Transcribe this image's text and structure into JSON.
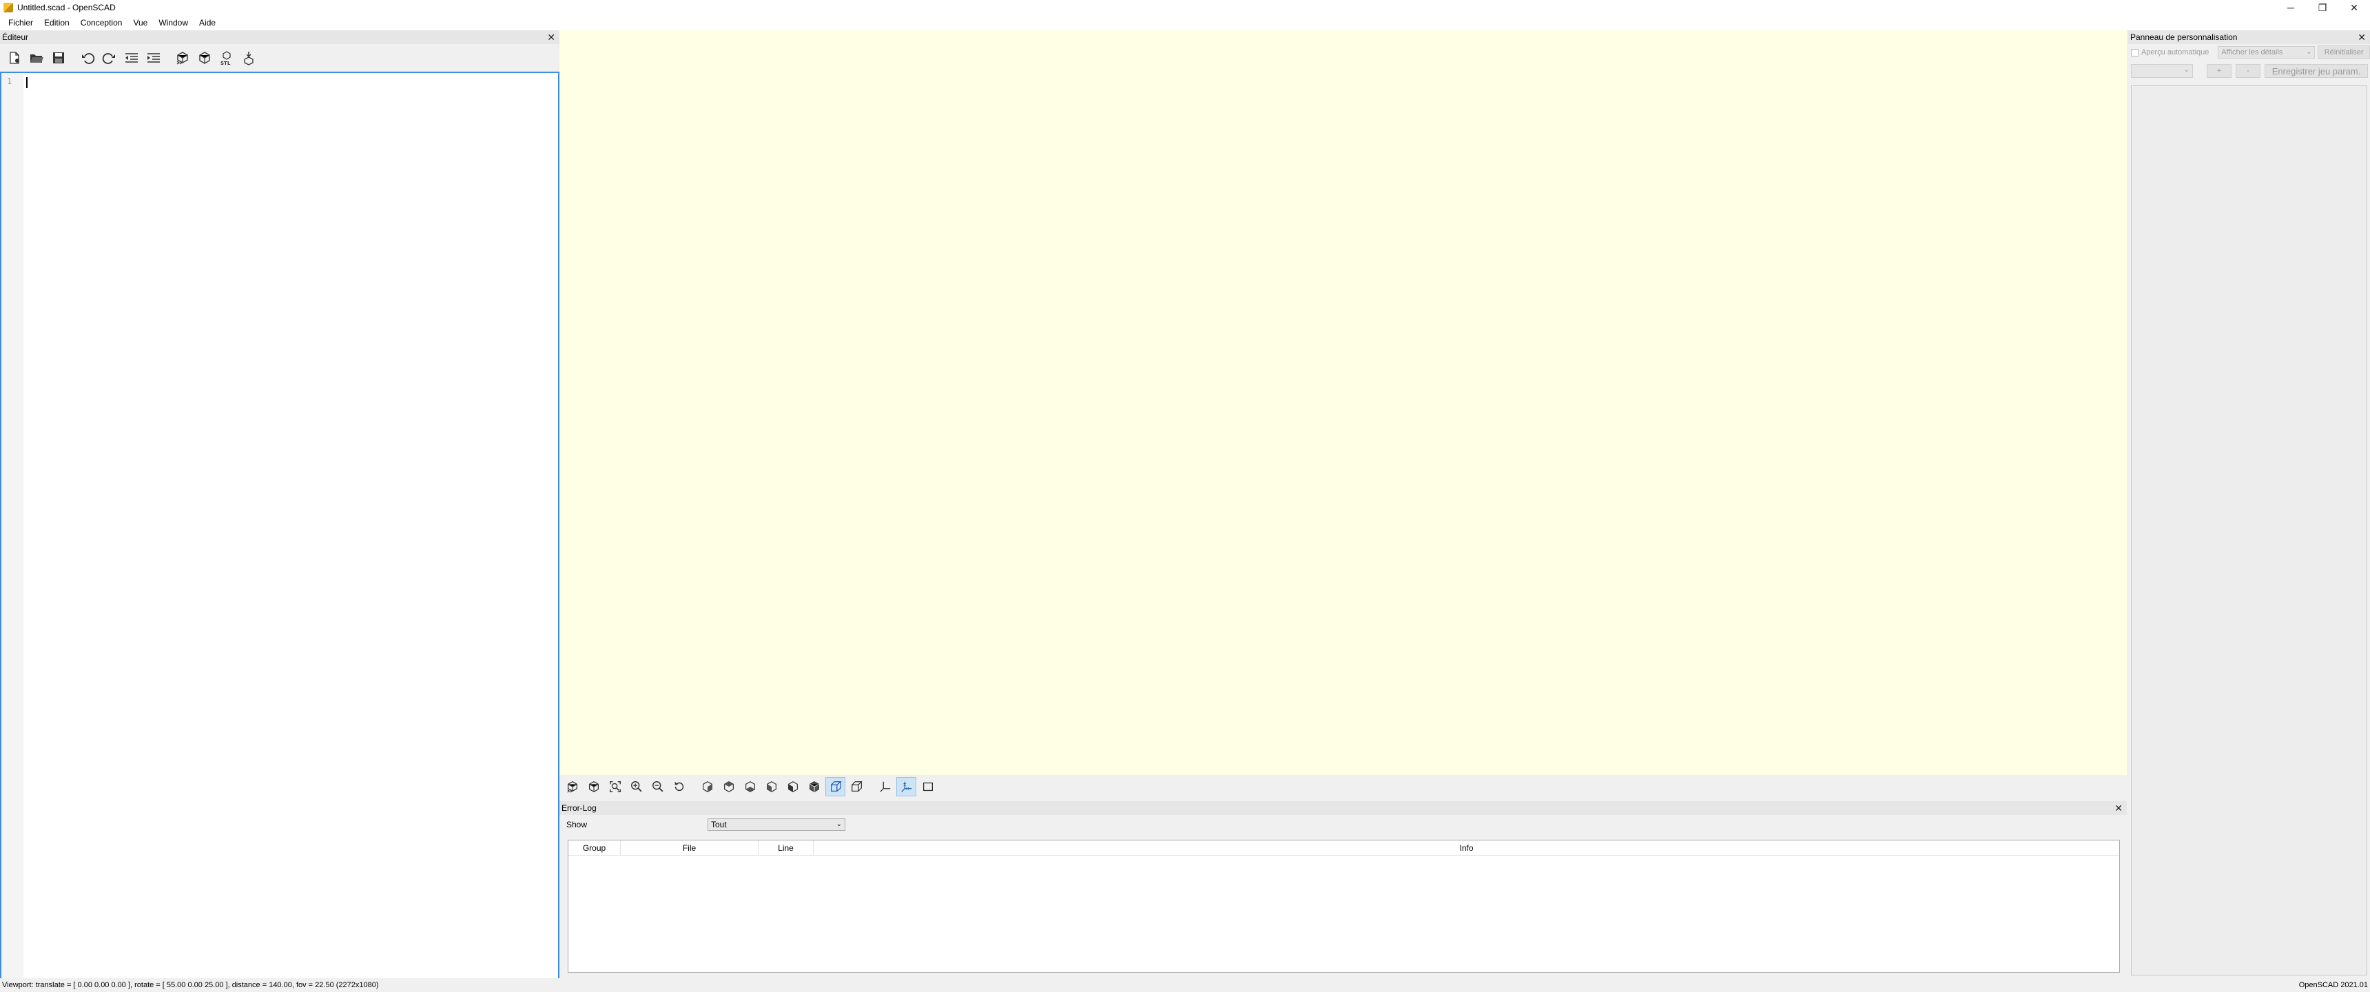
{
  "window": {
    "title": "Untitled.scad - OpenSCAD",
    "controls": {
      "minimize": "─",
      "restore": "❐",
      "close": "✕"
    }
  },
  "menubar": {
    "items": [
      "Fichier",
      "Edition",
      "Conception",
      "Vue",
      "Window",
      "Aide"
    ]
  },
  "editor": {
    "dock_title": "Éditeur",
    "close": "✕",
    "line_numbers": [
      "1"
    ],
    "content": ""
  },
  "errorlog": {
    "dock_title": "Error-Log",
    "close": "✕",
    "show_label": "Show",
    "show_value": "Tout",
    "columns": [
      "Group",
      "File",
      "Line",
      "Info"
    ]
  },
  "customizer": {
    "dock_title": "Panneau de personnalisation",
    "close": "✕",
    "auto_preview_label": "Aperçu automatique",
    "details_select": "Afficher les détails",
    "reset_button": "Réinitialiser",
    "add_button": "+",
    "remove_button": "-",
    "save_button": "Enregistrer jeu param."
  },
  "statusbar": {
    "viewport_info": "Viewport: translate = [ 0.00 0.00 0.00 ], rotate = [ 55.00 0.00 25.00 ], distance = 140.00, fov = 22.50 (2272x1080)",
    "version": "OpenSCAD 2021.01"
  },
  "colors": {
    "viewport_bg": "#ffffe6",
    "editor_focus_border": "#3a8ee6",
    "active_toggle": "#cde4f7"
  }
}
